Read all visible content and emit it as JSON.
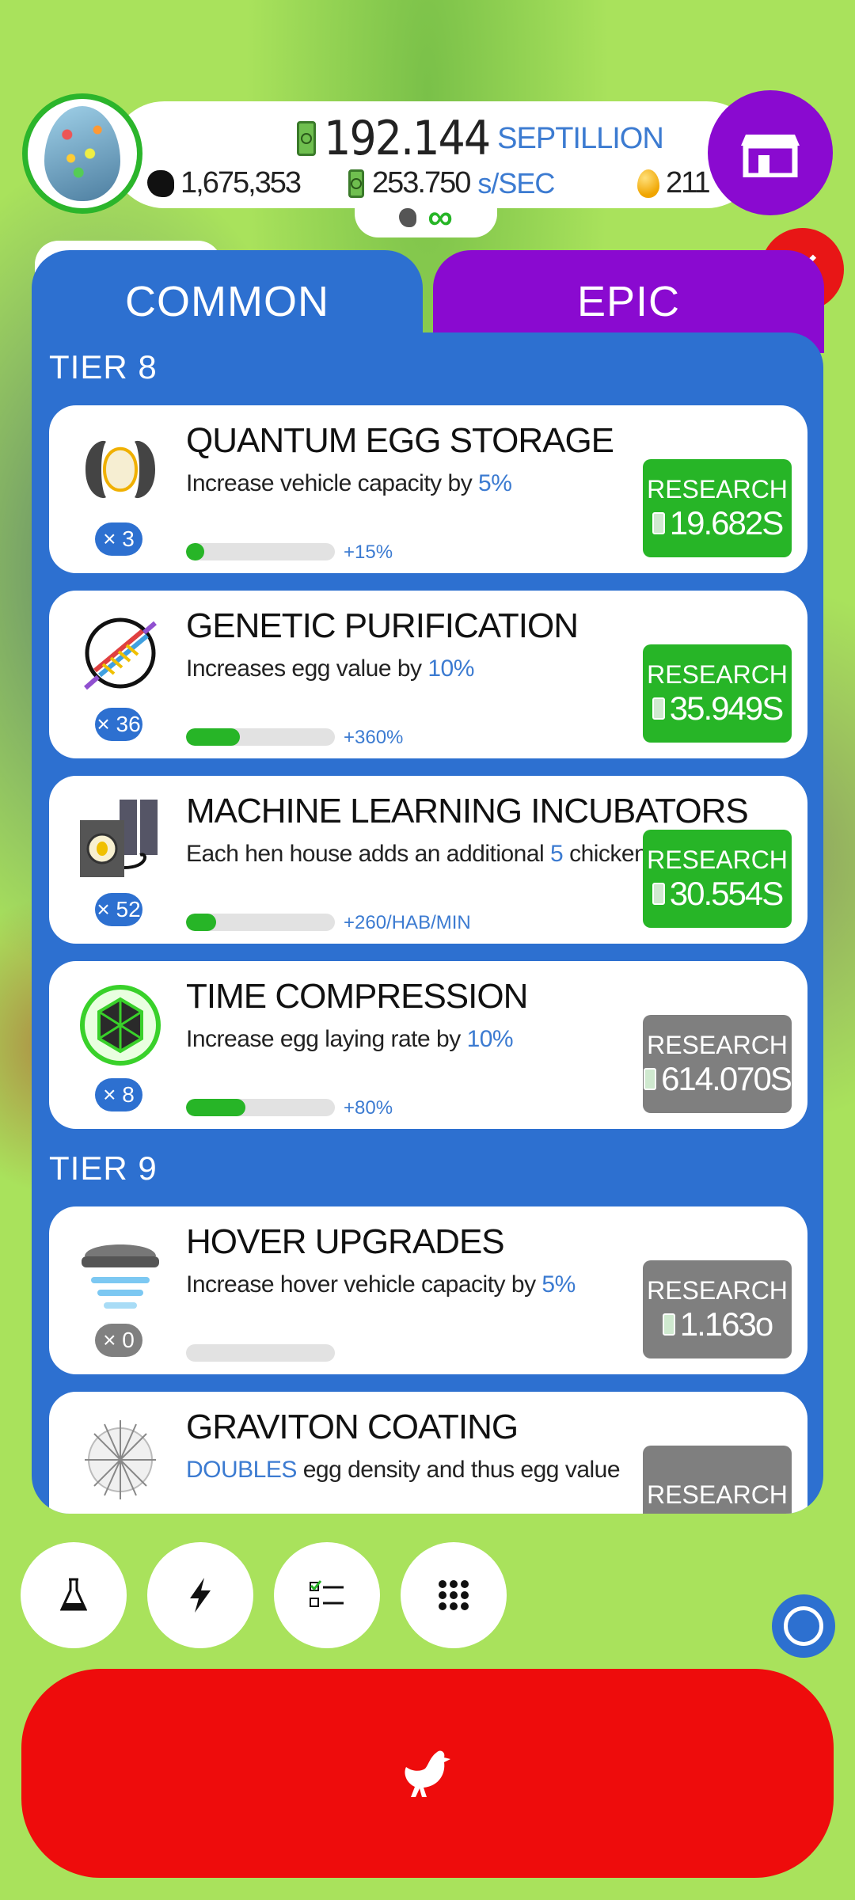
{
  "header": {
    "money_value": "192.144",
    "money_unit": "SEPTILLION",
    "chickens": "1,675,353",
    "rate_value": "253.750",
    "rate_unit": "s/SEC",
    "golden_eggs": "211",
    "infinity": "∞"
  },
  "tabs": [
    {
      "label": "COMMON",
      "active": true,
      "color": "#2d70d0"
    },
    {
      "label": "EPIC",
      "active": false,
      "color": "#8a0ad0"
    }
  ],
  "tiers": [
    {
      "label": "TIER 8",
      "items": [
        {
          "title": "QUANTUM EGG STORAGE",
          "desc_pre": "Increase vehicle capacity by ",
          "desc_hl": "5%",
          "desc_post": "",
          "count": "× 3",
          "progress": 0.12,
          "bonus": "+15%",
          "button": "RESEARCH",
          "price": "19.682S",
          "affordable": true,
          "icon": "egg-storage-icon"
        },
        {
          "title": "GENETIC PURIFICATION",
          "desc_pre": "Increases egg value by ",
          "desc_hl": "10%",
          "desc_post": "",
          "count": "× 36",
          "progress": 0.36,
          "bonus": "+360%",
          "button": "RESEARCH",
          "price": "35.949S",
          "affordable": true,
          "icon": "dna-icon"
        },
        {
          "title": "MACHINE LEARNING INCUBATORS",
          "desc_pre": "Each hen house adds an additional ",
          "desc_hl": "5",
          "desc_post": " chickens/min",
          "count": "× 52",
          "progress": 0.2,
          "bonus": "+260/HAB/MIN",
          "button": "RESEARCH",
          "price": "30.554S",
          "affordable": true,
          "icon": "incubator-icon"
        },
        {
          "title": "TIME COMPRESSION",
          "desc_pre": "Increase egg laying rate by ",
          "desc_hl": "10%",
          "desc_post": "",
          "count": "× 8",
          "progress": 0.4,
          "bonus": "+80%",
          "button": "RESEARCH",
          "price": "614.070S",
          "affordable": false,
          "icon": "time-compression-icon"
        }
      ]
    },
    {
      "label": "TIER 9",
      "items": [
        {
          "title": "HOVER UPGRADES",
          "desc_pre": "Increase hover vehicle capacity by ",
          "desc_hl": "5%",
          "desc_post": "",
          "count": "× 0",
          "progress": 0,
          "bonus": "",
          "button": "RESEARCH",
          "price": "1.163o",
          "affordable": false,
          "icon": "hover-icon"
        },
        {
          "title": "GRAVITON COATING",
          "desc_pre": "",
          "desc_hl": "DOUBLES",
          "desc_post": " egg density and thus egg value",
          "count": "",
          "progress": 0,
          "bonus": "",
          "button": "RESEARCH",
          "price": "",
          "affordable": false,
          "icon": "graviton-icon"
        }
      ]
    }
  ],
  "bottom_buttons": [
    "flask-icon",
    "lightning-icon",
    "checklist-icon",
    "grid-icon"
  ],
  "colors": {
    "green": "#27b527",
    "blue": "#2d70d0",
    "purple": "#8a0ad0",
    "red": "#ee0c0c",
    "gray": "#7f7f7f"
  }
}
